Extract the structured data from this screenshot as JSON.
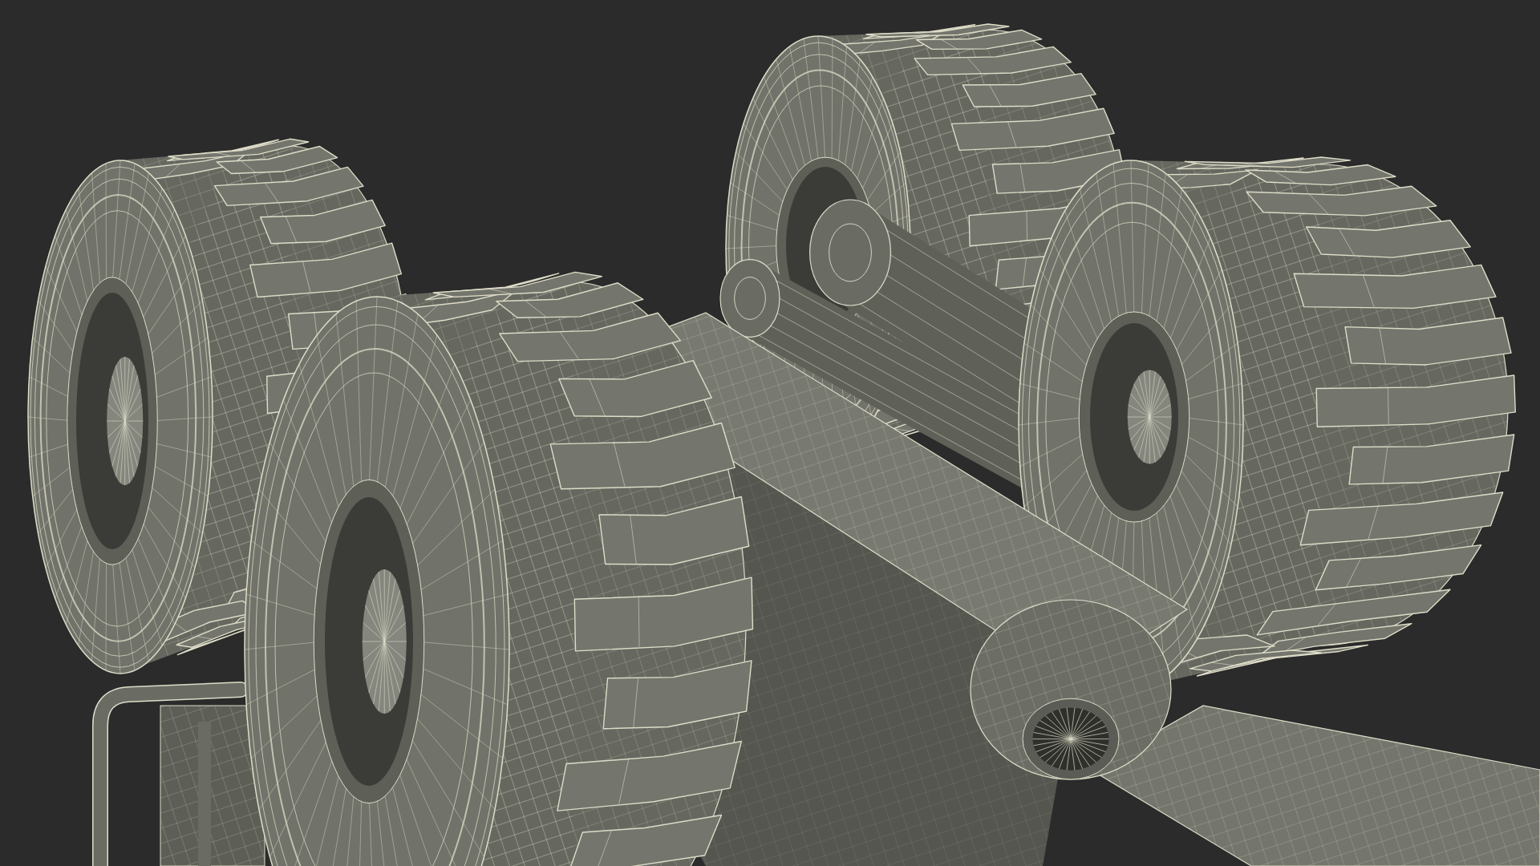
{
  "render": {
    "parts": [
      {
        "kind": "tire"
      },
      {
        "kind": "axle-tube"
      },
      {
        "kind": "suspension-arm"
      },
      {
        "kind": "tire"
      },
      {
        "kind": "tire"
      },
      {
        "kind": "pipe-frame"
      },
      {
        "kind": "chassis-beam"
      },
      {
        "kind": "differential"
      },
      {
        "kind": "tire"
      }
    ]
  }
}
